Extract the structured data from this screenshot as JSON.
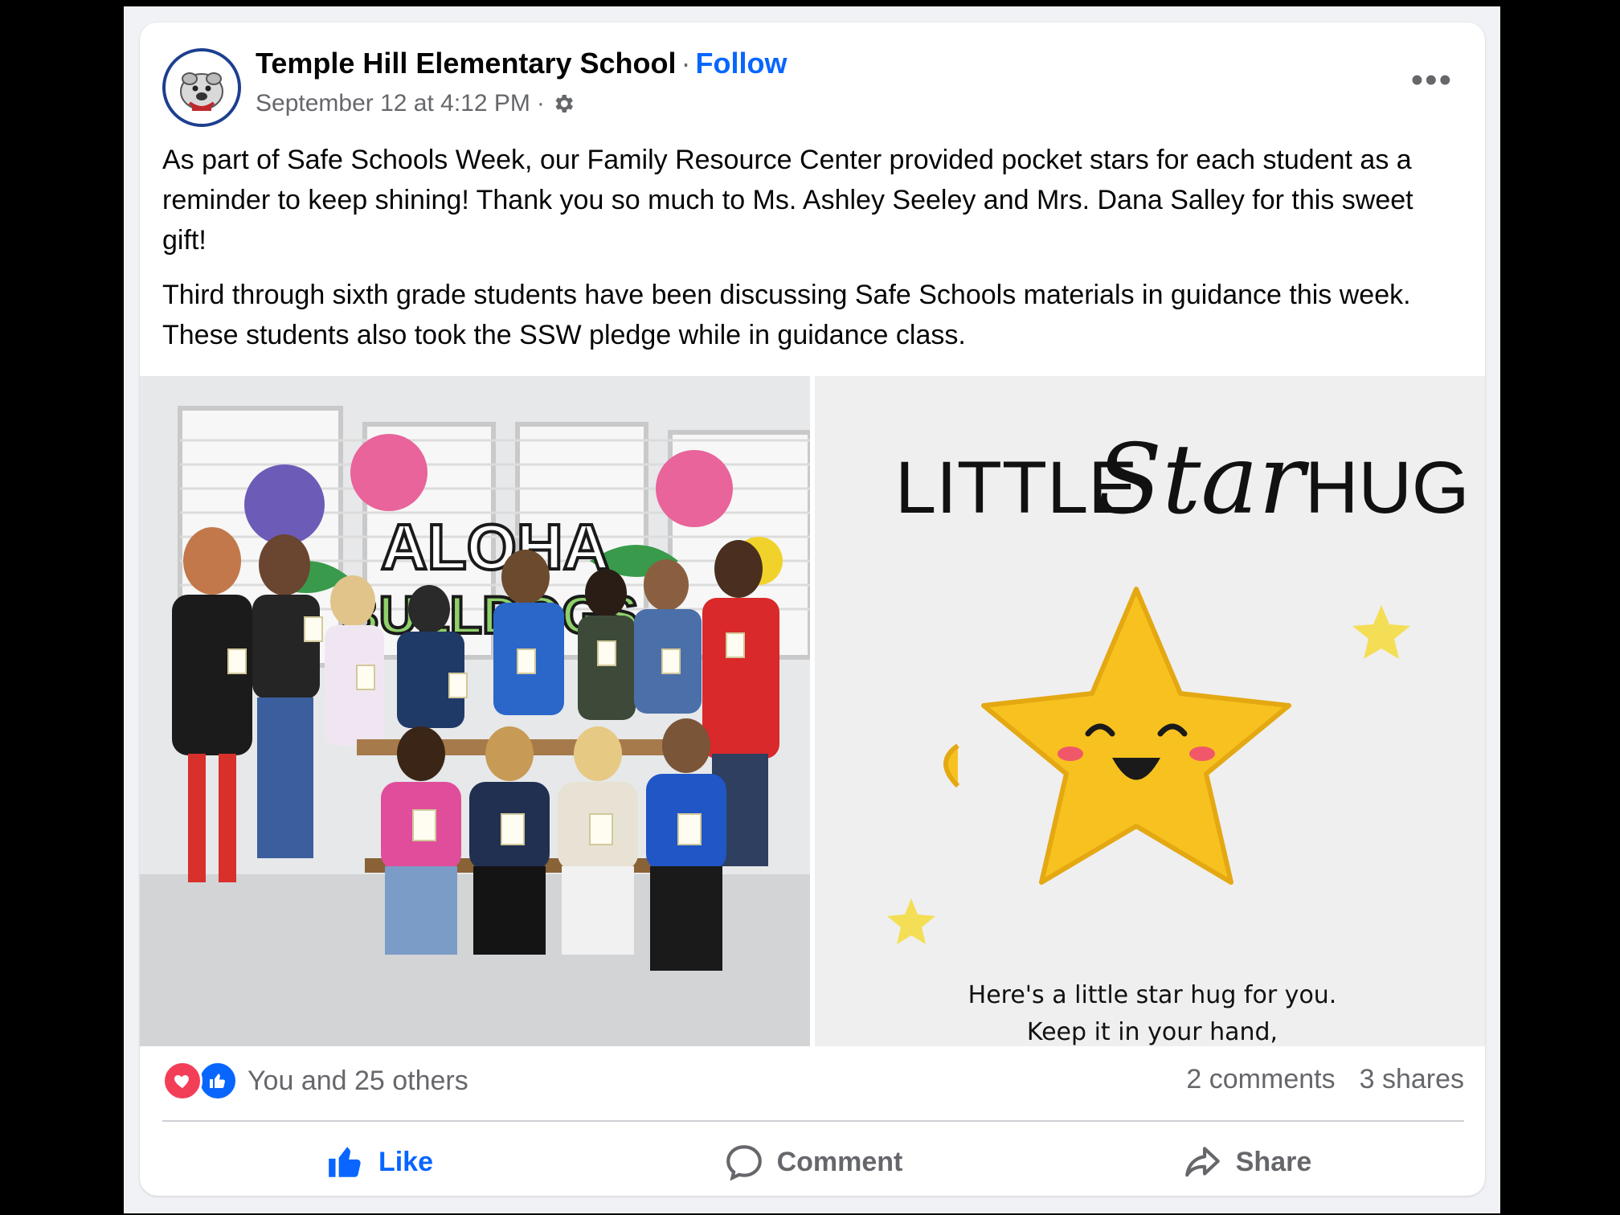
{
  "post": {
    "author": "Temple Hill Elementary School",
    "separator": "·",
    "follow_label": "Follow",
    "timestamp": "September 12 at 4:12 PM",
    "meta_separator": "·",
    "audience_icon": "gear-icon",
    "more_label": "•••",
    "paragraphs": [
      "As part of Safe Schools Week, our Family Resource Center provided pocket stars for each student as a reminder to keep shining! Thank you so much to Ms. Ashley Seeley and Mrs. Dana Salley for this sweet gift!",
      "Third through sixth grade students have been discussing Safe Schools materials in guidance this week. These students also took the SSW pledge while in guidance class."
    ]
  },
  "photos": {
    "left": {
      "sign_line1": "ALOHA",
      "sign_line2": "BULLDOGS"
    },
    "right": {
      "card_title_a": "LITTLE",
      "card_title_b": "Star",
      "card_title_c": "HUG",
      "card_line1": "Here's a little star hug for you.",
      "card_line2": "Keep it in your hand,"
    }
  },
  "stats": {
    "reaction_icons": [
      "heart-icon",
      "thumbs-up-icon"
    ],
    "reactions_text": "You and 25 others",
    "comments": "2 comments",
    "shares": "3 shares"
  },
  "actions": {
    "like": "Like",
    "comment": "Comment",
    "share": "Share"
  },
  "colors": {
    "brand_blue": "#0866ff",
    "love_red": "#f33e58",
    "secondary_text": "#65676b",
    "star_yellow": "#f7c21f"
  }
}
